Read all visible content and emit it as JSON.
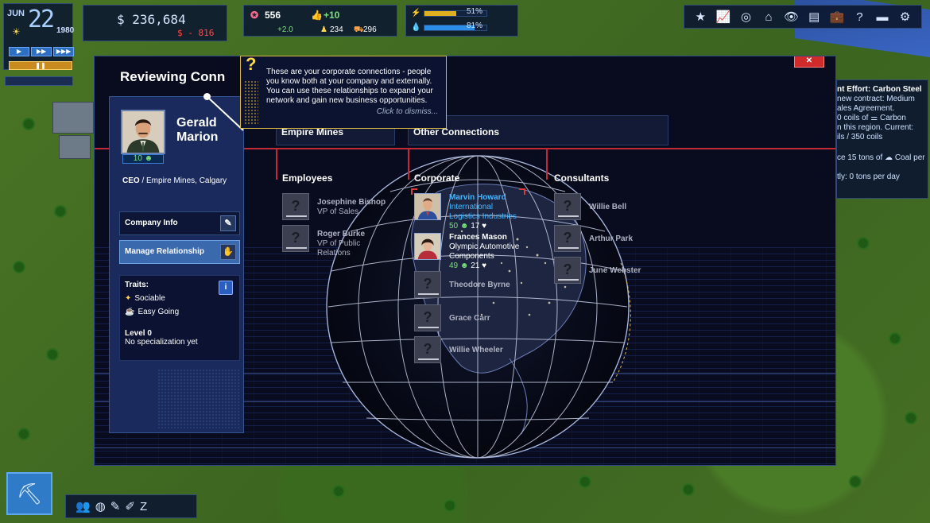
{
  "hud": {
    "month": "JUN",
    "day": "22",
    "year": "1980",
    "money": "$ 236,684",
    "money_change": "$ - 816",
    "reputation": "556",
    "reputation_delta": "+2.0",
    "approval": "+10",
    "workers": "234",
    "vehicles": "296",
    "power_percent": "51%",
    "water_percent": "81%",
    "power_fill": 0.51,
    "water_fill": 0.81
  },
  "quest_panel": {
    "line1": "nt Effort: Carbon Steel",
    "line2": "new contract: Medium",
    "line3": "ales Agreement.",
    "line4": "0 coils of ⚌ Carbon",
    "line5": "n this region. Current:",
    "line6": "ils / 350 coils",
    "line7": "ce 15 tons of ☁ Coal per",
    "line8": "tly: 0 tons per day"
  },
  "dialog": {
    "title": "Reviewing Conn",
    "close_label": "✕"
  },
  "profile": {
    "name_first": "Gerald",
    "name_last": "Marion",
    "level_badge": "10 ☻",
    "role": "CEO",
    "company": "/ Empire Mines, Calgary",
    "company_info_label": "Company Info",
    "manage_label": "Manage Relationship",
    "traits_heading": "Traits:",
    "traits": [
      "Sociable",
      "Easy Going"
    ],
    "level": "Level 0",
    "specialization": "No specialization yet"
  },
  "tabs": {
    "empire": "Empire Mines",
    "other": "Other Connections"
  },
  "columns": {
    "employees": "Employees",
    "corporate": "Corporate",
    "consultants": "Consultants"
  },
  "employees": [
    {
      "name": "Josephine Bishop",
      "title": "VP of Sales"
    },
    {
      "name": "Roger Burke",
      "title": "VP of Public Relations"
    }
  ],
  "corporate": [
    {
      "name": "Marvin Howard",
      "title": "International Logistics Industries",
      "stat1": "50 ☻",
      "stat2": "17 ♥"
    },
    {
      "name": "Frances Mason",
      "title": "Olympic Automotive Components",
      "stat1": "49 ☻",
      "stat2": "21 ♥"
    },
    {
      "name": "Theodore Byrne"
    },
    {
      "name": "Grace Carr"
    },
    {
      "name": "Willie Wheeler"
    }
  ],
  "consultants": [
    {
      "name": "Willie Bell"
    },
    {
      "name": "Arthur Park"
    },
    {
      "name": "June Webster"
    }
  ],
  "tooltip": {
    "text": "These are your corporate connections - people you know both at your company and externally. You can use these relationships to expand your network and gain new business opportunities.",
    "dismiss": "Click to dismiss..."
  },
  "unknown_glyph": "?",
  "colors": {
    "accent_blue": "#42b7ff",
    "selection_red": "#e03b3b",
    "panel_bg": "#080c1e",
    "positive_green": "#7de07d"
  }
}
